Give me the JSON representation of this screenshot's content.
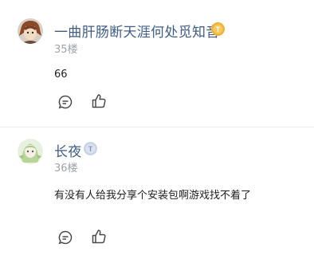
{
  "comments": [
    {
      "author": "一曲肝肠断天涯何处觅知音",
      "badge": {
        "icon": "level-coin-icon",
        "letter": "T",
        "color": "#f2b23a"
      },
      "floor": "35楼",
      "text": "66",
      "actions": {
        "comment_icon": "comment-icon",
        "like_icon": "thumbs-up-icon"
      }
    },
    {
      "author": "长夜",
      "badge": {
        "icon": "level-coin-icon",
        "letter": "T",
        "color": "#c9d3e8"
      },
      "floor": "36楼",
      "text": "有没有人给我分享个安装包啊游戏找不着了",
      "actions": {
        "comment_icon": "comment-icon",
        "like_icon": "thumbs-up-icon"
      }
    }
  ],
  "colors": {
    "author": "#3f5c87",
    "floor": "#a0a3a8",
    "text": "#1f1f1f",
    "icon": "#4a4a4a"
  }
}
